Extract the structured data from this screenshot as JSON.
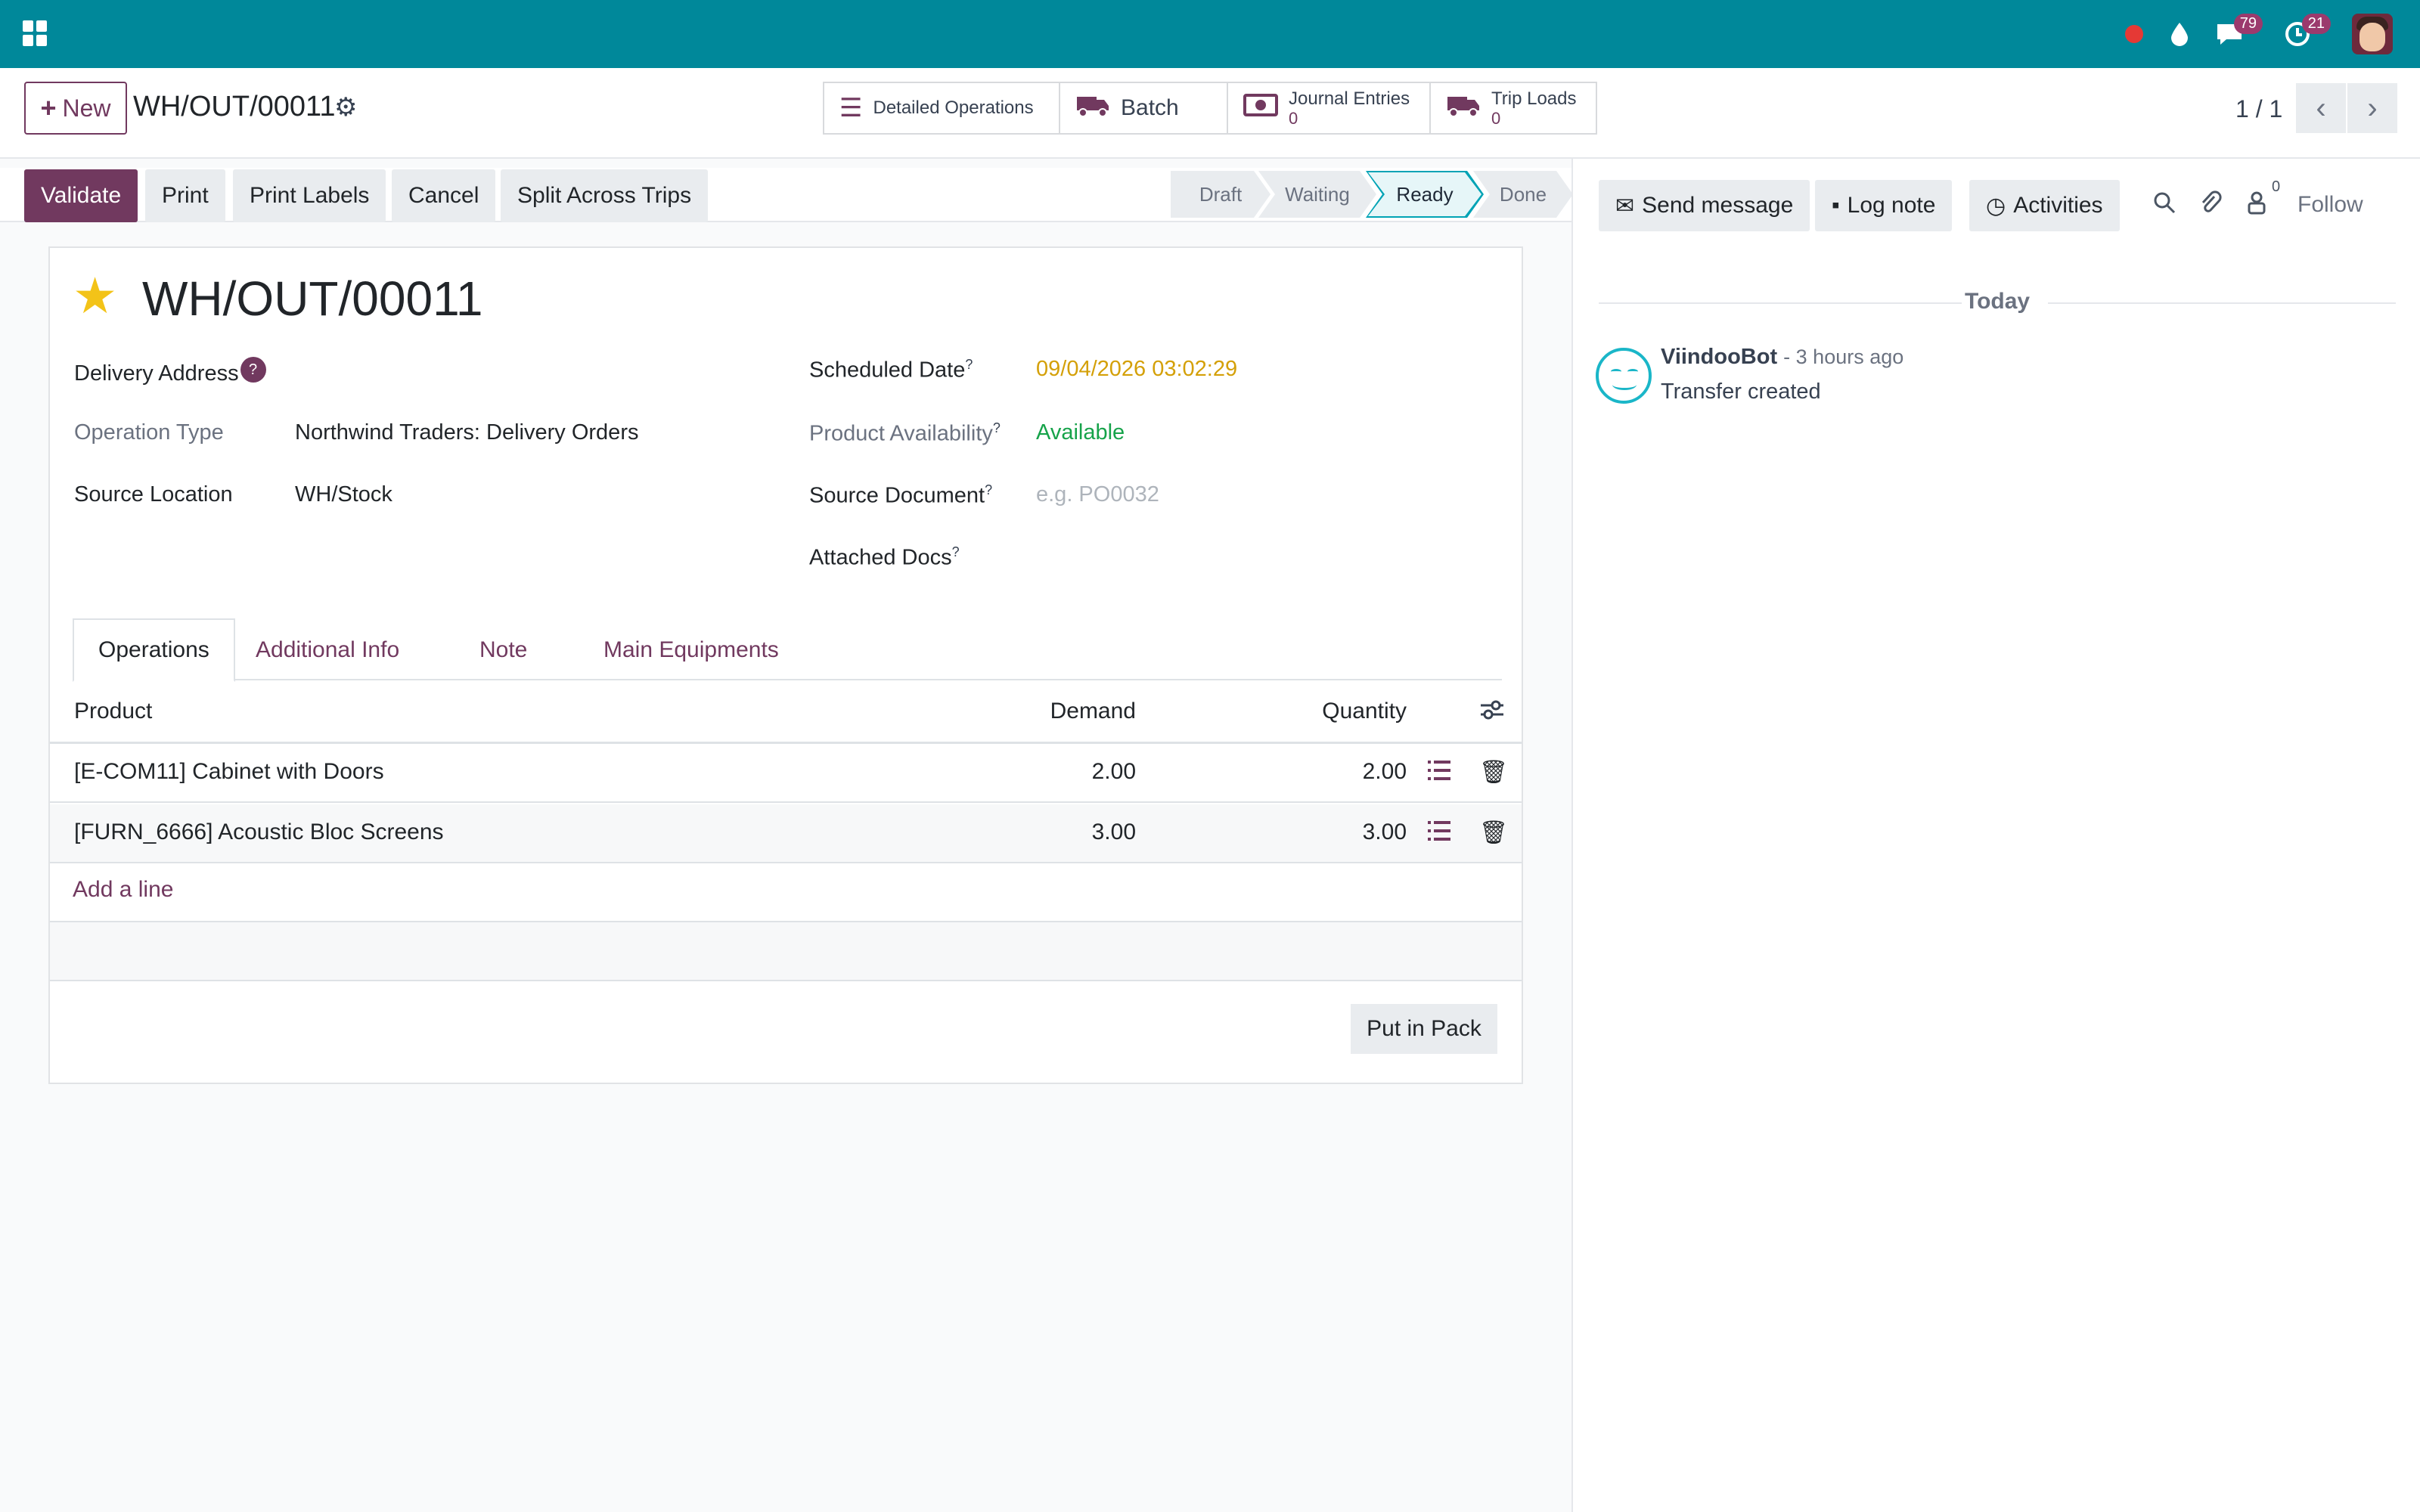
{
  "topbar": {
    "chat_count": "79",
    "activity_count": "21",
    "colors": {
      "bar": "#00889a",
      "brand": "#71395f"
    }
  },
  "control_panel": {
    "new_label": "New",
    "record_name": "WH/OUT/00011",
    "smart_buttons": {
      "detailed_operations": "Detailed Operations",
      "batch": "Batch",
      "journal_entries": {
        "label": "Journal Entries",
        "count": "0"
      },
      "trip_loads": {
        "label": "Trip Loads",
        "count": "0"
      }
    },
    "pager": "1 / 1"
  },
  "actions": {
    "validate": "Validate",
    "print": "Print",
    "print_labels": "Print Labels",
    "cancel": "Cancel",
    "split_across_trips": "Split Across Trips"
  },
  "stages": [
    {
      "label": "Draft"
    },
    {
      "label": "Waiting"
    },
    {
      "label": "Ready",
      "active": true
    },
    {
      "label": "Done"
    }
  ],
  "form": {
    "title": "WH/OUT/00011",
    "delivery_address_label": "Delivery Address",
    "delivery_address_help": "?",
    "operation_type_label": "Operation Type",
    "operation_type": "Northwind Traders: Delivery Orders",
    "source_location_label": "Source Location",
    "source_location": "WH/Stock",
    "scheduled_date_label": "Scheduled Date",
    "scheduled_date": "09/04/2026 03:02:29",
    "product_availability_label": "Product Availability",
    "product_availability": "Available",
    "source_document_label": "Source Document",
    "source_document_placeholder": "e.g. PO0032",
    "attached_docs_label": "Attached Docs",
    "help_mark": "?"
  },
  "tabs": [
    "Operations",
    "Additional Info",
    "Note",
    "Main Equipments"
  ],
  "table": {
    "columns": {
      "product": "Product",
      "demand": "Demand",
      "quantity": "Quantity"
    },
    "rows": [
      {
        "product": "[E-COM11] Cabinet with Doors",
        "demand": "2.00",
        "quantity": "2.00"
      },
      {
        "product": "[FURN_6666] Acoustic Bloc Screens",
        "demand": "3.00",
        "quantity": "3.00"
      }
    ],
    "add_line": "Add a line"
  },
  "put_in_pack": "Put in Pack",
  "chatter": {
    "send_message": "Send message",
    "log_note": "Log note",
    "activities": "Activities",
    "follower_count": "0",
    "follow": "Follow",
    "separator": "Today",
    "message": {
      "author": "ViindooBot",
      "time": "- 3 hours ago",
      "body": "Transfer created"
    }
  }
}
